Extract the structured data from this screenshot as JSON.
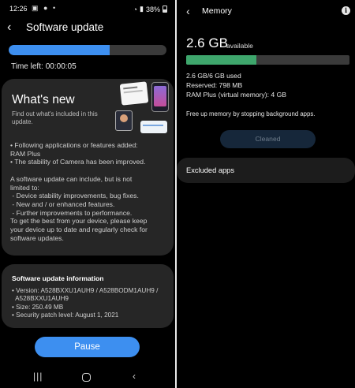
{
  "status_bar": {
    "time": "12:26",
    "battery": "38%"
  },
  "software_update": {
    "title": "Software update",
    "progress": 0.64,
    "time_left_label": "Time left:",
    "time_left_value": "00:00:05",
    "whats_new": {
      "title": "What's new",
      "subtitle": "Find out what's included in this update.",
      "body_lines": [
        "• Following applications or features added:",
        "RAM Plus",
        "• The stability of Camera has been improved.",
        "",
        "A software update can include, but is not",
        "limited to:",
        " - Device stability improvements, bug fixes.",
        " - New and / or enhanced features.",
        " - Further improvements to performance.",
        "To get the best from your device, please keep",
        "your device up to date and regularly check for",
        "software updates."
      ]
    },
    "info": {
      "title": "Software update information",
      "lines": [
        "• Version: A528BXXU1AUH9 / A528BODM1AUH9 /",
        "  A528BXXU1AUH9",
        "• Size: 250.49 MB",
        "• Security patch level: August 1, 2021"
      ]
    },
    "pause_label": "Pause"
  },
  "memory": {
    "title": "Memory",
    "available_value": "2.6 GB",
    "available_label": "available",
    "used_fraction": 0.43,
    "stats": [
      "2.6 GB/6 GB used",
      "Reserved: 798 MB",
      "RAM Plus (virtual memory): 4 GB"
    ],
    "free_up_text": "Free up memory by stopping background apps.",
    "clean_label": "Cleaned",
    "excluded_label": "Excluded apps"
  },
  "colors": {
    "accent": "#3d8ff0",
    "memory_bar": "#3ea66c",
    "card": "#262626"
  }
}
